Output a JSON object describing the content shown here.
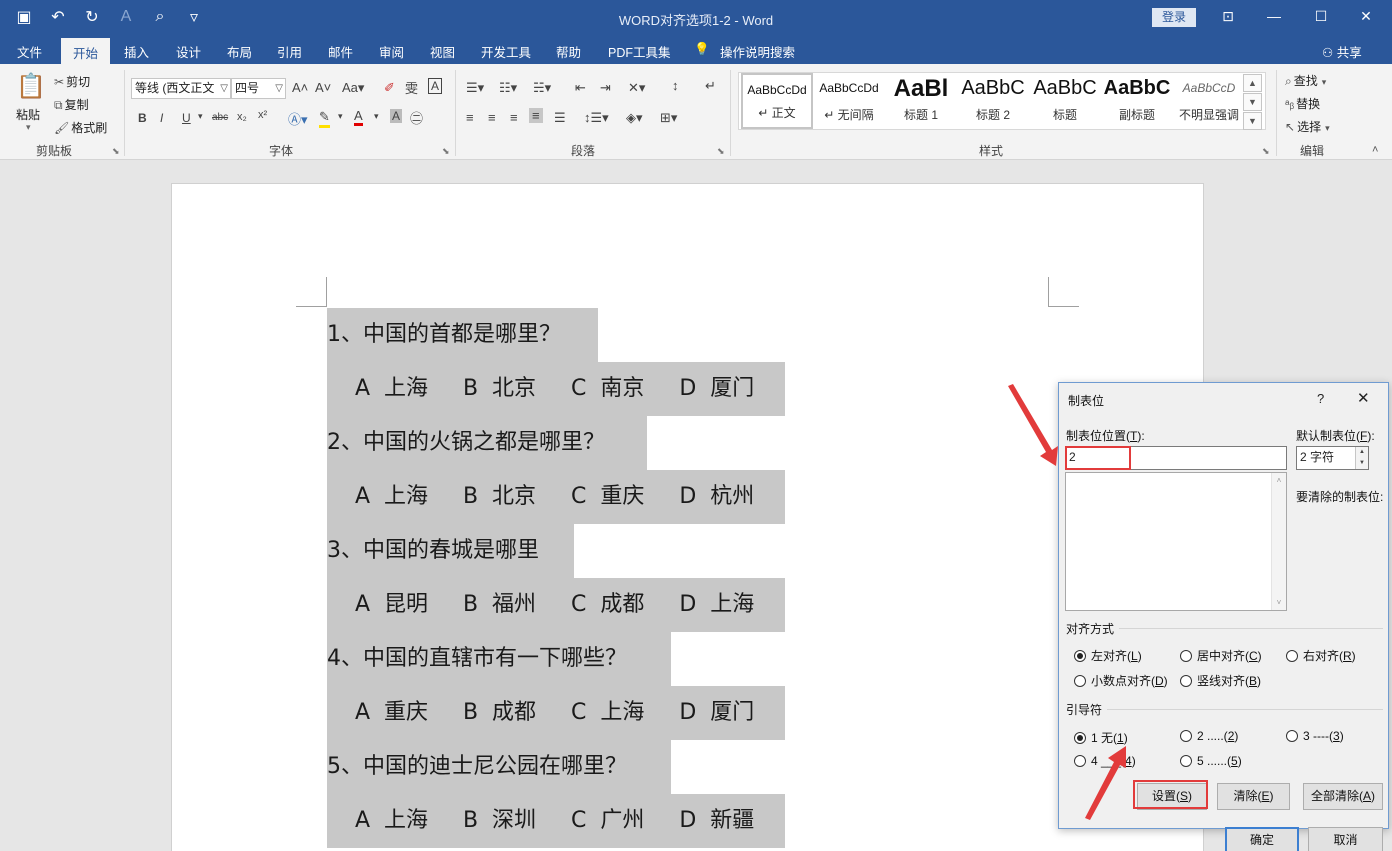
{
  "titlebar": {
    "title": "WORD对齐选项1-2  -  Word",
    "login": "登录"
  },
  "tabs": [
    "文件",
    "开始",
    "插入",
    "设计",
    "布局",
    "引用",
    "邮件",
    "审阅",
    "视图",
    "开发工具",
    "帮助",
    "PDF工具集",
    "操作说明搜索"
  ],
  "share": "共享",
  "ribbon": {
    "clipboard": {
      "paste": "粘贴",
      "cut": "剪切",
      "copy": "复制",
      "format_painter": "格式刷",
      "label": "剪贴板"
    },
    "font": {
      "font_name": "等线 (西文正文",
      "font_size": "四号",
      "label": "字体"
    },
    "paragraph": {
      "label": "段落"
    },
    "styles": {
      "label": "样式",
      "items": [
        {
          "preview": "AaBbCcDd",
          "name": "↵ 正文"
        },
        {
          "preview": "AaBbCcDd",
          "name": "↵ 无间隔"
        },
        {
          "preview": "AaBl",
          "name": "标题 1"
        },
        {
          "preview": "AaBbC",
          "name": "标题 2"
        },
        {
          "preview": "AaBbC",
          "name": "标题"
        },
        {
          "preview": "AaBbC",
          "name": "副标题"
        },
        {
          "preview": "AaBbCcD",
          "name": "不明显强调"
        }
      ]
    },
    "editing": {
      "find": "查找",
      "replace": "替换",
      "select": "选择",
      "label": "编辑"
    }
  },
  "document": {
    "lines": [
      "1、中国的首都是哪里？",
      "    A  上海     B  北京     C  南京     D  厦门",
      "2、中国的火锅之都是哪里？",
      "    A  上海     B  北京     C  重庆     D  杭州",
      "3、中国的春城是哪里",
      "    A  昆明     B  福州     C  成都     D  上海",
      "4、中国的直辖市有一下哪些？",
      "    A  重庆     B  成都     C  上海     D  厦门",
      "5、中国的迪士尼公园在哪里？",
      "    A  上海     B  深圳     C  广州     D  新疆"
    ]
  },
  "dialog": {
    "title": "制表位",
    "help": "?",
    "tab_position_label": "制表位位置(",
    "tab_position_key": "T",
    "tab_position_value": "2",
    "default_tab_label": "默认制表位(",
    "default_tab_key": "F",
    "default_tab_value": "2 字符",
    "to_clear_label": "要清除的制表位:",
    "alignment_label": "对齐方式",
    "alignment": [
      {
        "label": "左对齐(",
        "key": "L",
        "selected": true
      },
      {
        "label": "居中对齐(",
        "key": "C",
        "selected": false
      },
      {
        "label": "右对齐(",
        "key": "R",
        "selected": false
      },
      {
        "label": "小数点对齐(",
        "key": "D",
        "selected": false
      },
      {
        "label": "竖线对齐(",
        "key": "B",
        "selected": false
      }
    ],
    "leader_label": "引导符",
    "leaders": [
      {
        "label": "1 无(",
        "key": "1",
        "selected": true
      },
      {
        "label": "2 .....(",
        "key": "2",
        "selected": false
      },
      {
        "label": "3 ----(",
        "key": "3",
        "selected": false
      },
      {
        "label": "4 ___(",
        "key": "4",
        "selected": false
      },
      {
        "label": "5 ......(",
        "key": "5",
        "selected": false
      }
    ],
    "buttons": {
      "set": "设置(",
      "set_key": "S",
      "clear": "清除(",
      "clear_key": "E",
      "clear_all": "全部清除(",
      "clear_all_key": "A",
      "ok": "确定",
      "cancel": "取消"
    }
  },
  "colors": {
    "accent": "#2b579a",
    "highlight": "#e23b3b",
    "selection": "#c8c8c8"
  }
}
